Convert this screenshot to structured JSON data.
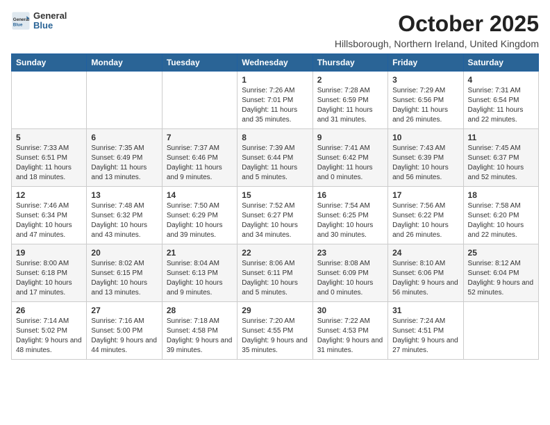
{
  "logo": {
    "general": "General",
    "blue": "Blue"
  },
  "title": "October 2025",
  "location": "Hillsborough, Northern Ireland, United Kingdom",
  "days_of_week": [
    "Sunday",
    "Monday",
    "Tuesday",
    "Wednesday",
    "Thursday",
    "Friday",
    "Saturday"
  ],
  "weeks": [
    [
      {
        "day": "",
        "info": ""
      },
      {
        "day": "",
        "info": ""
      },
      {
        "day": "",
        "info": ""
      },
      {
        "day": "1",
        "info": "Sunrise: 7:26 AM\nSunset: 7:01 PM\nDaylight: 11 hours and 35 minutes."
      },
      {
        "day": "2",
        "info": "Sunrise: 7:28 AM\nSunset: 6:59 PM\nDaylight: 11 hours and 31 minutes."
      },
      {
        "day": "3",
        "info": "Sunrise: 7:29 AM\nSunset: 6:56 PM\nDaylight: 11 hours and 26 minutes."
      },
      {
        "day": "4",
        "info": "Sunrise: 7:31 AM\nSunset: 6:54 PM\nDaylight: 11 hours and 22 minutes."
      }
    ],
    [
      {
        "day": "5",
        "info": "Sunrise: 7:33 AM\nSunset: 6:51 PM\nDaylight: 11 hours and 18 minutes."
      },
      {
        "day": "6",
        "info": "Sunrise: 7:35 AM\nSunset: 6:49 PM\nDaylight: 11 hours and 13 minutes."
      },
      {
        "day": "7",
        "info": "Sunrise: 7:37 AM\nSunset: 6:46 PM\nDaylight: 11 hours and 9 minutes."
      },
      {
        "day": "8",
        "info": "Sunrise: 7:39 AM\nSunset: 6:44 PM\nDaylight: 11 hours and 5 minutes."
      },
      {
        "day": "9",
        "info": "Sunrise: 7:41 AM\nSunset: 6:42 PM\nDaylight: 11 hours and 0 minutes."
      },
      {
        "day": "10",
        "info": "Sunrise: 7:43 AM\nSunset: 6:39 PM\nDaylight: 10 hours and 56 minutes."
      },
      {
        "day": "11",
        "info": "Sunrise: 7:45 AM\nSunset: 6:37 PM\nDaylight: 10 hours and 52 minutes."
      }
    ],
    [
      {
        "day": "12",
        "info": "Sunrise: 7:46 AM\nSunset: 6:34 PM\nDaylight: 10 hours and 47 minutes."
      },
      {
        "day": "13",
        "info": "Sunrise: 7:48 AM\nSunset: 6:32 PM\nDaylight: 10 hours and 43 minutes."
      },
      {
        "day": "14",
        "info": "Sunrise: 7:50 AM\nSunset: 6:29 PM\nDaylight: 10 hours and 39 minutes."
      },
      {
        "day": "15",
        "info": "Sunrise: 7:52 AM\nSunset: 6:27 PM\nDaylight: 10 hours and 34 minutes."
      },
      {
        "day": "16",
        "info": "Sunrise: 7:54 AM\nSunset: 6:25 PM\nDaylight: 10 hours and 30 minutes."
      },
      {
        "day": "17",
        "info": "Sunrise: 7:56 AM\nSunset: 6:22 PM\nDaylight: 10 hours and 26 minutes."
      },
      {
        "day": "18",
        "info": "Sunrise: 7:58 AM\nSunset: 6:20 PM\nDaylight: 10 hours and 22 minutes."
      }
    ],
    [
      {
        "day": "19",
        "info": "Sunrise: 8:00 AM\nSunset: 6:18 PM\nDaylight: 10 hours and 17 minutes."
      },
      {
        "day": "20",
        "info": "Sunrise: 8:02 AM\nSunset: 6:15 PM\nDaylight: 10 hours and 13 minutes."
      },
      {
        "day": "21",
        "info": "Sunrise: 8:04 AM\nSunset: 6:13 PM\nDaylight: 10 hours and 9 minutes."
      },
      {
        "day": "22",
        "info": "Sunrise: 8:06 AM\nSunset: 6:11 PM\nDaylight: 10 hours and 5 minutes."
      },
      {
        "day": "23",
        "info": "Sunrise: 8:08 AM\nSunset: 6:09 PM\nDaylight: 10 hours and 0 minutes."
      },
      {
        "day": "24",
        "info": "Sunrise: 8:10 AM\nSunset: 6:06 PM\nDaylight: 9 hours and 56 minutes."
      },
      {
        "day": "25",
        "info": "Sunrise: 8:12 AM\nSunset: 6:04 PM\nDaylight: 9 hours and 52 minutes."
      }
    ],
    [
      {
        "day": "26",
        "info": "Sunrise: 7:14 AM\nSunset: 5:02 PM\nDaylight: 9 hours and 48 minutes."
      },
      {
        "day": "27",
        "info": "Sunrise: 7:16 AM\nSunset: 5:00 PM\nDaylight: 9 hours and 44 minutes."
      },
      {
        "day": "28",
        "info": "Sunrise: 7:18 AM\nSunset: 4:58 PM\nDaylight: 9 hours and 39 minutes."
      },
      {
        "day": "29",
        "info": "Sunrise: 7:20 AM\nSunset: 4:55 PM\nDaylight: 9 hours and 35 minutes."
      },
      {
        "day": "30",
        "info": "Sunrise: 7:22 AM\nSunset: 4:53 PM\nDaylight: 9 hours and 31 minutes."
      },
      {
        "day": "31",
        "info": "Sunrise: 7:24 AM\nSunset: 4:51 PM\nDaylight: 9 hours and 27 minutes."
      },
      {
        "day": "",
        "info": ""
      }
    ]
  ]
}
